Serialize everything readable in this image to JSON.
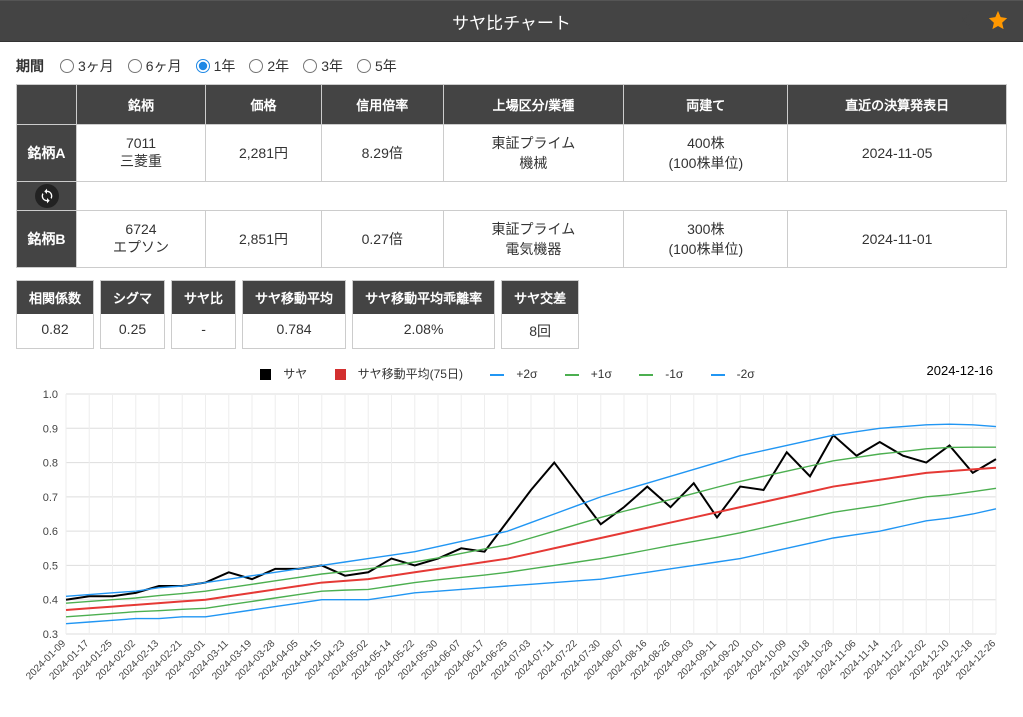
{
  "header": {
    "title": "サヤ比チャート"
  },
  "period": {
    "label": "期間",
    "options": [
      "3ヶ月",
      "6ヶ月",
      "1年",
      "2年",
      "3年",
      "5年"
    ],
    "selected": "1年"
  },
  "table": {
    "headers": [
      "銘柄",
      "価格",
      "信用倍率",
      "上場区分/業種",
      "両建て",
      "直近の決算発表日"
    ],
    "rowA": {
      "label": "銘柄A",
      "code": "7011",
      "name": "三菱重",
      "price": "2,281円",
      "margin": "8.29倍",
      "market1": "東証プライム",
      "market2": "機械",
      "lots1": "400株",
      "lots2": "(100株単位)",
      "earnings": "2024-11-05"
    },
    "rowB": {
      "label": "銘柄B",
      "code": "6724",
      "name": "エプソン",
      "price": "2,851円",
      "margin": "0.27倍",
      "market1": "東証プライム",
      "market2": "電気機器",
      "lots1": "300株",
      "lots2": "(100株単位)",
      "earnings": "2024-11-01"
    }
  },
  "metrics": [
    {
      "label": "相関係数",
      "value": "0.82"
    },
    {
      "label": "シグマ",
      "value": "0.25"
    },
    {
      "label": "サヤ比",
      "value": "-"
    },
    {
      "label": "サヤ移動平均",
      "value": "0.784"
    },
    {
      "label": "サヤ移動平均乖離率",
      "value": "2.08%"
    },
    {
      "label": "サヤ交差",
      "value": "8回"
    }
  ],
  "chart_date": "2024-12-16",
  "legend": {
    "saya": "サヤ",
    "ma": "サヤ移動平均(75日)",
    "p2s": "+2σ",
    "p1s": "+1σ",
    "m1s": "-1σ",
    "m2s": "-2σ"
  },
  "chart_data": {
    "type": "line",
    "title": "",
    "xlabel": "",
    "ylabel": "",
    "ylim": [
      0.3,
      1.0
    ],
    "x_ticks": [
      "2024-01-09",
      "2024-01-17",
      "2024-01-25",
      "2024-02-02",
      "2024-02-13",
      "2024-02-21",
      "2024-03-01",
      "2024-03-11",
      "2024-03-19",
      "2024-03-28",
      "2024-04-05",
      "2024-04-15",
      "2024-04-23",
      "2024-05-02",
      "2024-05-14",
      "2024-05-22",
      "2024-05-30",
      "2024-06-07",
      "2024-06-17",
      "2024-06-25",
      "2024-07-03",
      "2024-07-11",
      "2024-07-22",
      "2024-07-30",
      "2024-08-07",
      "2024-08-16",
      "2024-08-26",
      "2024-09-03",
      "2024-09-11",
      "2024-09-20",
      "2024-10-01",
      "2024-10-09",
      "2024-10-18",
      "2024-10-28",
      "2024-11-06",
      "2024-11-14",
      "2024-11-22",
      "2024-12-02",
      "2024-12-10",
      "2024-12-18",
      "2024-12-26"
    ],
    "series": [
      {
        "name": "サヤ",
        "color": "#000",
        "values": [
          0.4,
          0.41,
          0.41,
          0.42,
          0.44,
          0.44,
          0.45,
          0.48,
          0.46,
          0.49,
          0.49,
          0.5,
          0.47,
          0.48,
          0.52,
          0.5,
          0.52,
          0.55,
          0.54,
          0.63,
          0.72,
          0.8,
          0.71,
          0.62,
          0.67,
          0.73,
          0.67,
          0.74,
          0.64,
          0.73,
          0.72,
          0.83,
          0.76,
          0.88,
          0.82,
          0.86,
          0.82,
          0.8,
          0.85,
          0.77,
          0.81
        ]
      },
      {
        "name": "サヤ移動平均(75日)",
        "color": "#e53935",
        "values": [
          0.37,
          0.375,
          0.38,
          0.385,
          0.39,
          0.395,
          0.4,
          0.41,
          0.42,
          0.43,
          0.44,
          0.45,
          0.455,
          0.46,
          0.47,
          0.48,
          0.49,
          0.5,
          0.51,
          0.52,
          0.535,
          0.55,
          0.565,
          0.58,
          0.595,
          0.61,
          0.625,
          0.64,
          0.655,
          0.67,
          0.685,
          0.7,
          0.715,
          0.73,
          0.74,
          0.75,
          0.76,
          0.77,
          0.775,
          0.78,
          0.785
        ]
      },
      {
        "name": "+2σ",
        "color": "#2196f3",
        "values": [
          0.41,
          0.415,
          0.42,
          0.425,
          0.435,
          0.44,
          0.45,
          0.46,
          0.47,
          0.48,
          0.49,
          0.5,
          0.51,
          0.52,
          0.53,
          0.54,
          0.555,
          0.57,
          0.585,
          0.6,
          0.625,
          0.65,
          0.675,
          0.7,
          0.72,
          0.74,
          0.76,
          0.78,
          0.8,
          0.82,
          0.835,
          0.85,
          0.865,
          0.88,
          0.89,
          0.9,
          0.905,
          0.91,
          0.912,
          0.91,
          0.905
        ]
      },
      {
        "name": "+1σ",
        "color": "#4caf50",
        "values": [
          0.39,
          0.395,
          0.4,
          0.405,
          0.412,
          0.418,
          0.425,
          0.435,
          0.445,
          0.455,
          0.465,
          0.475,
          0.482,
          0.49,
          0.5,
          0.51,
          0.522,
          0.535,
          0.548,
          0.56,
          0.58,
          0.6,
          0.62,
          0.64,
          0.658,
          0.675,
          0.692,
          0.71,
          0.728,
          0.745,
          0.76,
          0.775,
          0.79,
          0.805,
          0.815,
          0.825,
          0.832,
          0.84,
          0.844,
          0.845,
          0.845
        ]
      },
      {
        "name": "-1σ",
        "color": "#4caf50",
        "values": [
          0.35,
          0.355,
          0.36,
          0.365,
          0.368,
          0.372,
          0.375,
          0.385,
          0.395,
          0.405,
          0.415,
          0.425,
          0.428,
          0.43,
          0.44,
          0.45,
          0.458,
          0.465,
          0.472,
          0.48,
          0.49,
          0.5,
          0.51,
          0.52,
          0.532,
          0.545,
          0.558,
          0.57,
          0.582,
          0.595,
          0.61,
          0.625,
          0.64,
          0.655,
          0.665,
          0.675,
          0.688,
          0.7,
          0.706,
          0.715,
          0.725
        ]
      },
      {
        "name": "-2σ",
        "color": "#2196f3",
        "values": [
          0.33,
          0.335,
          0.34,
          0.345,
          0.345,
          0.35,
          0.35,
          0.36,
          0.37,
          0.38,
          0.39,
          0.4,
          0.4,
          0.4,
          0.41,
          0.42,
          0.425,
          0.43,
          0.435,
          0.44,
          0.445,
          0.45,
          0.455,
          0.46,
          0.47,
          0.48,
          0.49,
          0.5,
          0.51,
          0.52,
          0.535,
          0.55,
          0.565,
          0.58,
          0.59,
          0.6,
          0.615,
          0.63,
          0.638,
          0.65,
          0.665
        ]
      }
    ]
  }
}
